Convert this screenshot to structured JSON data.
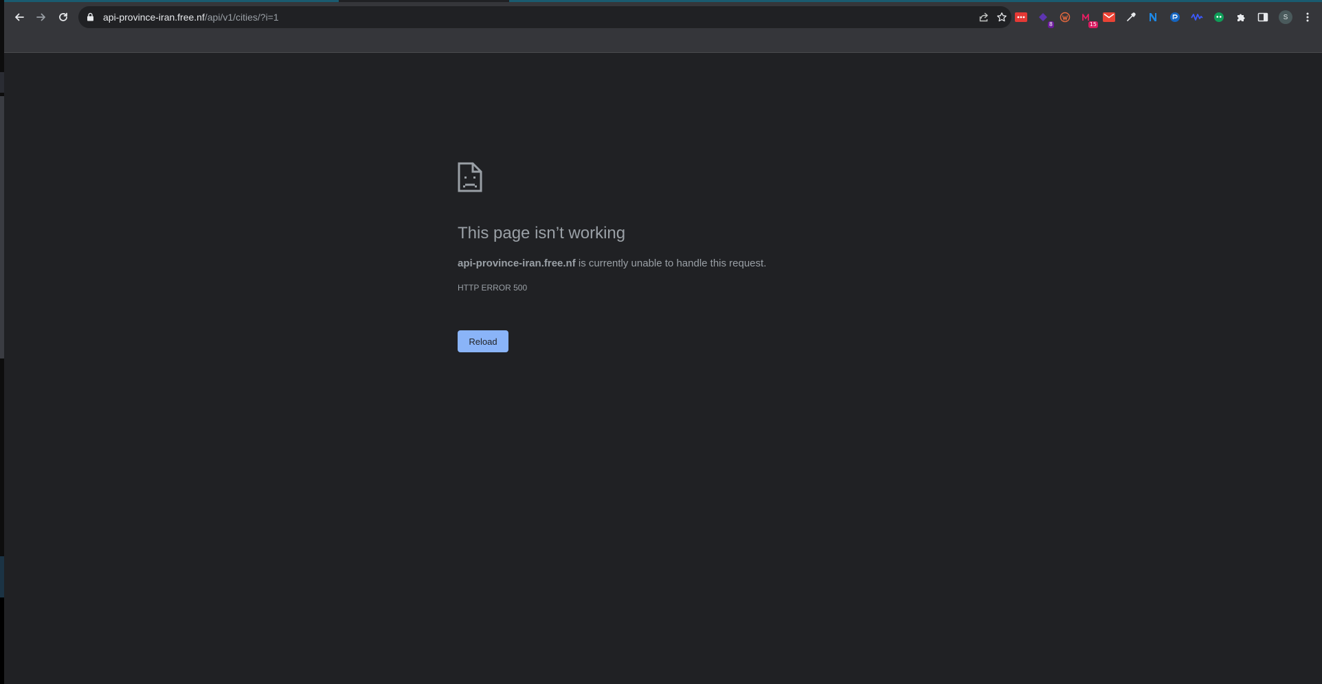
{
  "browser": {
    "address_bar": {
      "host": "api-province-iran.free.nf",
      "path": "/api/v1/cities/?i=1",
      "lock_icon": "lock-icon"
    },
    "nav": {
      "back_icon": "arrow-left-icon",
      "forward_icon": "arrow-right-icon",
      "reload_icon": "reload-icon"
    },
    "omnibox_actions": [
      "share-icon",
      "star-icon"
    ],
    "extensions": [
      {
        "name": "red-dots-extension-icon",
        "color": "#e53935"
      },
      {
        "name": "purple-extension-icon",
        "color": "#6a1b9a",
        "badge": "8"
      },
      {
        "name": "wordpress-extension-icon",
        "color": "#e8693e"
      },
      {
        "name": "m-extension-icon",
        "color": "#e91e63",
        "badge": "15"
      },
      {
        "name": "mail-extension-icon",
        "color": "#ea4335"
      },
      {
        "name": "eyedropper-extension-icon",
        "color": "#e8eaed"
      },
      {
        "name": "n-extension-icon",
        "color": "#1e88e5"
      },
      {
        "name": "circle-extension-icon",
        "color": "#1565c0"
      },
      {
        "name": "wave-extension-icon",
        "color": "#3d5afe"
      },
      {
        "name": "quote-extension-icon",
        "color": "#0f9d58"
      },
      {
        "name": "puzzle-extensions-icon",
        "color": "#e8eaed"
      },
      {
        "name": "sidepanel-icon",
        "color": "#e8eaed"
      }
    ],
    "profile_initial": "S",
    "menu_icon": "kebab-menu-icon"
  },
  "error_page": {
    "icon": "sad-page-icon",
    "title": "This page isn’t working",
    "host": "api-province-iran.free.nf",
    "message_suffix": " is currently unable to handle this request.",
    "error_code": "HTTP ERROR 500",
    "reload_label": "Reload"
  },
  "colors": {
    "background": "#202124",
    "toolbar": "#35363a",
    "text_secondary": "#9aa0a6",
    "button_blue": "#8ab4f8"
  }
}
